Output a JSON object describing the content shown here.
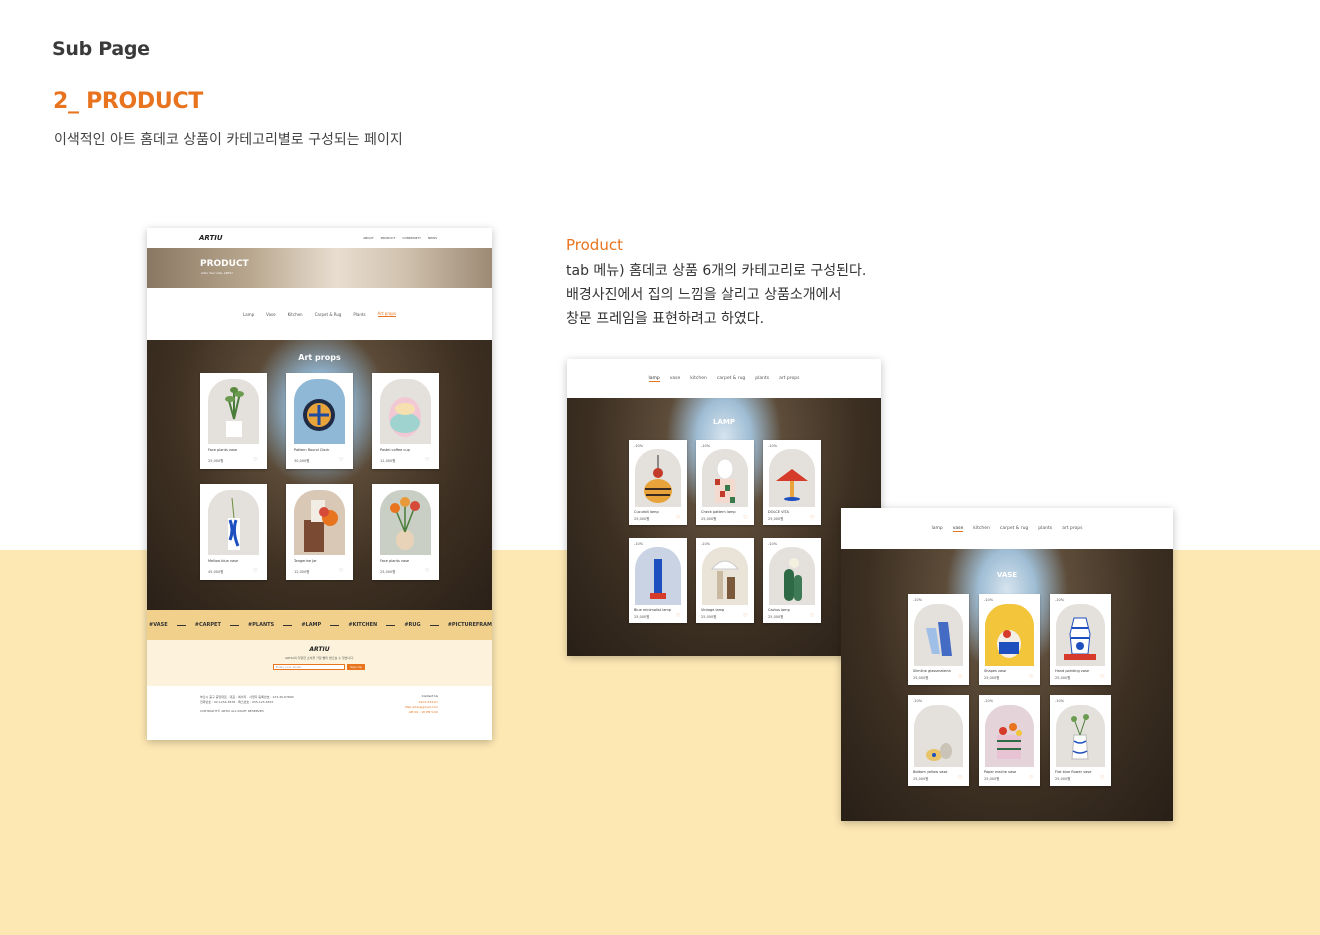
{
  "header": {
    "sub_page": "Sub Page",
    "title": "2_ PRODUCT",
    "description": "이색적인 아트 홈데코 상품이 카테고리별로 구성되는 페이지"
  },
  "description_block": {
    "title": "Product",
    "lines": [
      "tab 메뉴) 홈데코 상품 6개의 카테고리로 구성된다.",
      "배경사진에서 집의 느낌을 살리고 상품소개에서",
      "창문 프레임을 표현하려고 하였다."
    ]
  },
  "mockup_full": {
    "logo": "ARTIU",
    "nav": [
      "ABOUT",
      "PRODUCT",
      "COMMUNITY",
      "NEWS"
    ],
    "banner_title": "PRODUCT",
    "banner_subtitle": "Artiu Your Life, ARTIU",
    "tabs": [
      "Lamp",
      "Vase",
      "Kitchen",
      "Carpet & Rug",
      "Plants",
      "Art props"
    ],
    "active_tab": "Art props",
    "section_title": "Art props",
    "products": [
      {
        "name": "Face plants vase",
        "price": "25,000원"
      },
      {
        "name": "Pattern Round Clock",
        "price": "30,000원"
      },
      {
        "name": "Pastel coffee cup",
        "price": "12,000원"
      },
      {
        "name": "Mellow blue vase",
        "price": "45,000원"
      },
      {
        "name": "Tangerine Jar",
        "price": "12,000원"
      },
      {
        "name": "Face plants vase",
        "price": "25,000원"
      }
    ],
    "hashtags": [
      "#VASE",
      "#CARPET",
      "#PLANTS",
      "#LAMP",
      "#KITCHEN",
      "#RUG",
      "#PICTUREFRAM"
    ],
    "newsletter_logo": "ARTIU",
    "newsletter_text": "ARTIU의 다양한 소식을 가장 빨리 받으실 수 있습니다.",
    "newsletter_placeholder": "Enter your email",
    "newsletter_button": "Sign Up",
    "footer_lines": [
      "부산시 중구 중앙대로 · 대표 : 에이티 · 사업자 등록번호 : 123-45-67890",
      "전화번호 : 02-1234-5678 · 팩스번호 : 055-123-4567",
      "COPYRIGHT© ARTIU ALL RIGHT RESERVED"
    ],
    "footer_right": [
      "Contact Us",
      "0101-234-67",
      "Mail.Artiu@gmail.com",
      "AM 09 - 18 PM 5:00"
    ]
  },
  "mockup_lamp": {
    "tabs": [
      "lamp",
      "vase",
      "kitchen",
      "carpet & rug",
      "plants",
      "art props"
    ],
    "active_tab": "lamp",
    "section_title": "LAMP",
    "products": [
      {
        "name": "Cucurbit lamp",
        "price": "25,000원",
        "discount": "-10%"
      },
      {
        "name": "Check pattern lamp",
        "price": "25,000원",
        "discount": "-10%"
      },
      {
        "name": "DOLCE VITA",
        "price": "25,000원",
        "discount": "-10%"
      },
      {
        "name": "Blue minimalist lamp",
        "price": "25,000원",
        "discount": "-10%"
      },
      {
        "name": "Vintage lamp",
        "price": "25,000원",
        "discount": "-10%"
      },
      {
        "name": "Cactus lamp",
        "price": "25,000원",
        "discount": "-10%"
      }
    ]
  },
  "mockup_vase": {
    "tabs": [
      "lamp",
      "vase",
      "kitchen",
      "carpet & rug",
      "plants",
      "art props"
    ],
    "active_tab": "vase",
    "section_title": "VASE",
    "products": [
      {
        "name": "Slimline glassmateria",
        "price": "25,000원",
        "discount": "-10%"
      },
      {
        "name": "Shapes vase",
        "price": "25,000원",
        "discount": "-10%"
      },
      {
        "name": "Hand painting vase",
        "price": "25,000원",
        "discount": "-10%"
      },
      {
        "name": "Bottom yellow vase",
        "price": "25,000원",
        "discount": "-10%"
      },
      {
        "name": "Paper mache vase",
        "price": "25,000원",
        "discount": "-10%"
      },
      {
        "name": "Flat blue flower vase",
        "price": "25,000원",
        "discount": "-10%"
      }
    ]
  },
  "colors": {
    "accent": "#e8741f",
    "band": "#fde8b4",
    "strip": "#f1d08b",
    "newsletter_bg": "#fdf3dc"
  }
}
